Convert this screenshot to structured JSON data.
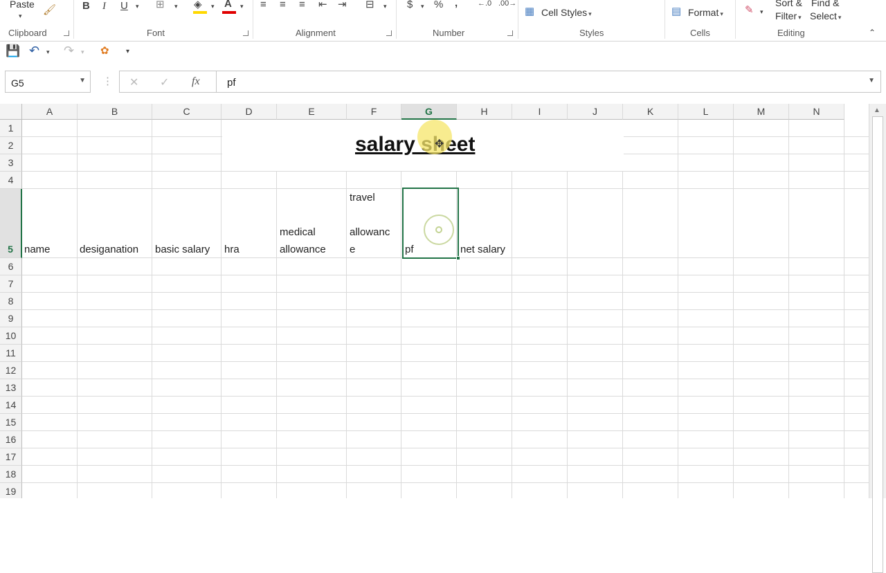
{
  "ribbon": {
    "paste": "Paste",
    "groups": {
      "clipboard": "Clipboard",
      "font": "Font",
      "alignment": "Alignment",
      "number": "Number",
      "styles": "Styles",
      "cells": "Cells",
      "editing": "Editing"
    },
    "cell_styles": "Cell Styles",
    "format": "Format",
    "sort_filter_line1": "Sort &",
    "sort_filter_line2": "Filter",
    "find_select_line1": "Find &",
    "find_select_line2": "Select",
    "font_buttons": {
      "bold": "B",
      "italic": "I",
      "underline": "U"
    },
    "number_buttons": {
      "currency": "$",
      "percent": "%",
      "comma": ","
    }
  },
  "formula_bar": {
    "name_box": "G5",
    "fx": "fx",
    "value": "pf"
  },
  "columns": [
    "A",
    "B",
    "C",
    "D",
    "E",
    "F",
    "G",
    "H",
    "I",
    "J",
    "K",
    "L",
    "M",
    "N"
  ],
  "rows": [
    "1",
    "2",
    "3",
    "4",
    "5",
    "6",
    "7",
    "8",
    "9",
    "10",
    "11",
    "12",
    "13",
    "14",
    "15",
    "16",
    "17",
    "18",
    "19"
  ],
  "selected": {
    "column": "G",
    "row": "5"
  },
  "sheet": {
    "title": "salary sheet",
    "headers": {
      "name": "name",
      "designation": "desiganation",
      "basic_salary": "basic salary",
      "hra": "hra",
      "medical_line1": "medical",
      "medical_line2": "allowance",
      "travel_line1": "travel",
      "travel_line2": "allowanc",
      "travel_line3": "e",
      "pf": "pf",
      "net_salary": "net salary"
    }
  },
  "colors": {
    "accent": "#217346",
    "highlight": "#f5e66a"
  }
}
